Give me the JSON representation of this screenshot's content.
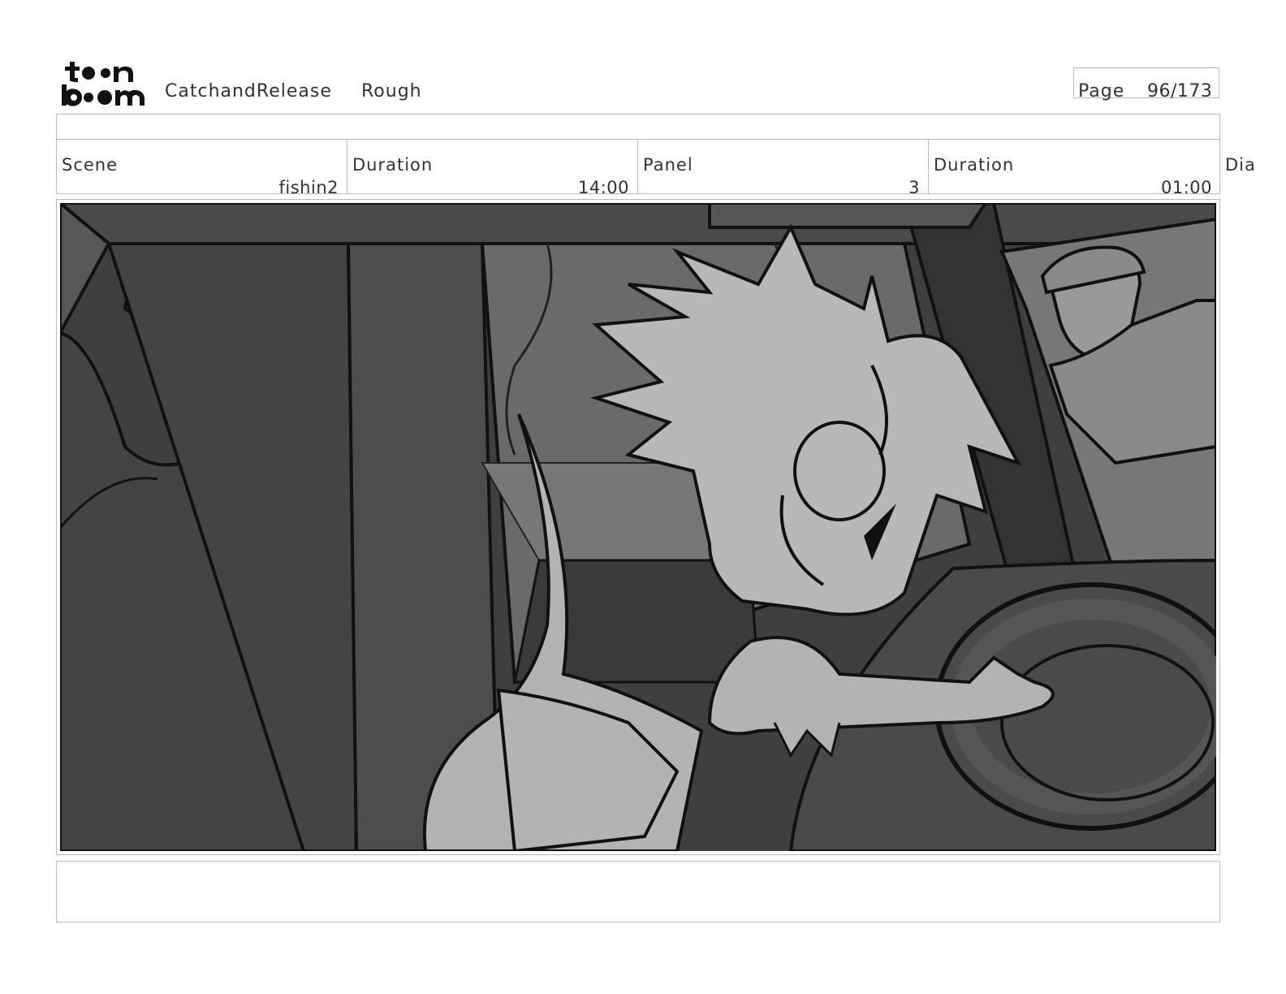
{
  "header": {
    "project": "CatchandRelease",
    "version": "Rough",
    "page_label": "Page",
    "page_number": "96/173"
  },
  "info": {
    "scene": {
      "label": "Scene",
      "value": "fishin2"
    },
    "scene_duration": {
      "label": "Duration",
      "value": "14:00"
    },
    "panel": {
      "label": "Panel",
      "value": "3"
    },
    "panel_duration": {
      "label": "Duration",
      "value": "01:00"
    },
    "dialogue_label": "Dia"
  },
  "panel_image": {
    "icon": "storyboard-panel-drawing"
  },
  "notes": {
    "text": ""
  }
}
